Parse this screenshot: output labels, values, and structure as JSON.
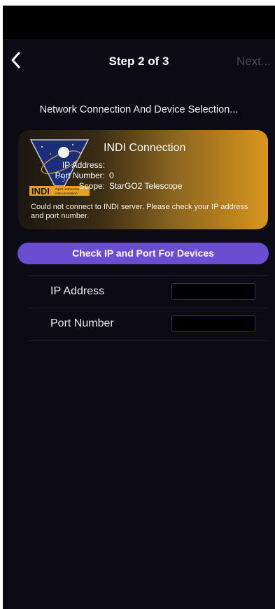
{
  "nav": {
    "back_icon": "chevron-left-icon",
    "title": "Step 2 of 3",
    "next_label": "Next..."
  },
  "section_title": "Network Connection And Device Selection...",
  "connection_card": {
    "logo_text": "INDI",
    "logo_subtext_line1": "Open Astronomy",
    "logo_subtext_line2": "Instrumentation",
    "title": "INDI Connection",
    "ip_label": "IP Address:",
    "ip_value": "",
    "port_label": "Port Number:",
    "port_value": "0",
    "scope_label": "Scope:",
    "scope_value": "StarGO2 Telescope",
    "message": "Could not connect to INDI server. Please check your IP address and port number.",
    "accent_color": "#d8961d"
  },
  "check_button_label": "Check IP and Port For Devices",
  "check_button_color": "#6a4ed1",
  "form": {
    "ip_label": "IP Address",
    "ip_value": "",
    "port_label": "Port Number",
    "port_value": ""
  }
}
